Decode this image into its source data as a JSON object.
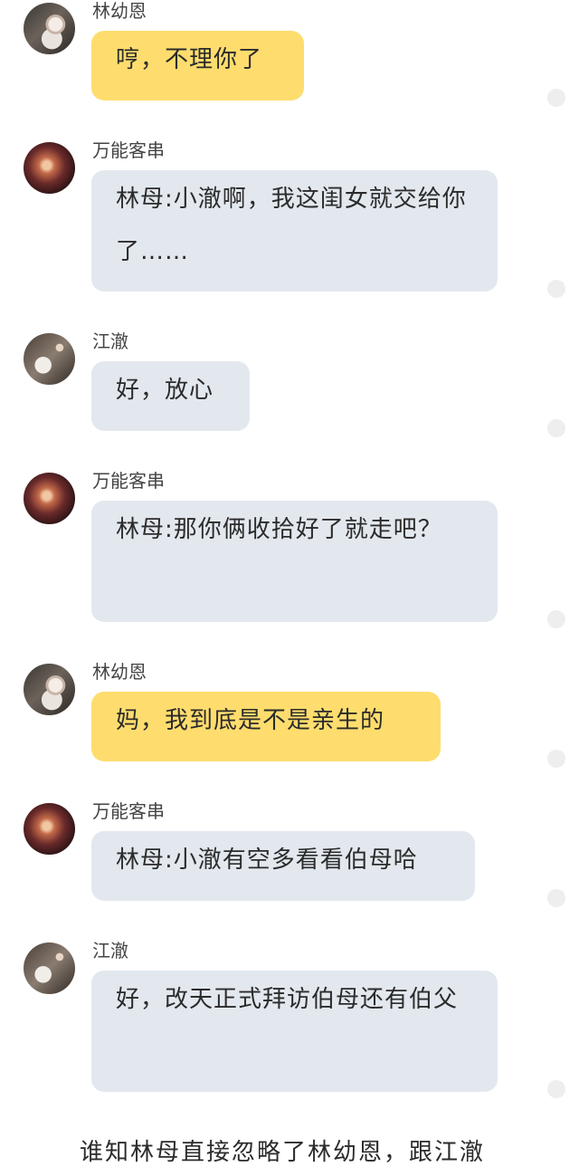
{
  "messages": [
    {
      "sender": "林幼恩",
      "avatar": "girl-avatar",
      "text": "哼，不理你了",
      "style": "yellow"
    },
    {
      "sender": "万能客串",
      "avatar": "galaxy-avatar",
      "text": "林母:小澈啊，我这闺女就交给你了……",
      "style": "gray"
    },
    {
      "sender": "江澈",
      "avatar": "boy-avatar",
      "text": "好，放心",
      "style": "gray"
    },
    {
      "sender": "万能客串",
      "avatar": "galaxy-avatar",
      "text": "林母:那你俩收拾好了就走吧？",
      "style": "gray"
    },
    {
      "sender": "林幼恩",
      "avatar": "girl-avatar",
      "text": "妈，我到底是不是亲生的",
      "style": "yellow"
    },
    {
      "sender": "万能客串",
      "avatar": "galaxy-avatar",
      "text": "林母:小澈有空多看看伯母哈",
      "style": "gray"
    },
    {
      "sender": "江澈",
      "avatar": "boy-avatar",
      "text": "好，改天正式拜访伯母还有伯父",
      "style": "gray"
    }
  ],
  "narration": "谁知林母直接忽略了林幼恩，跟江澈",
  "colors": {
    "yellow_bubble": "#fedd6e",
    "gray_bubble": "#e3e8ef",
    "background": "#ffffff"
  }
}
